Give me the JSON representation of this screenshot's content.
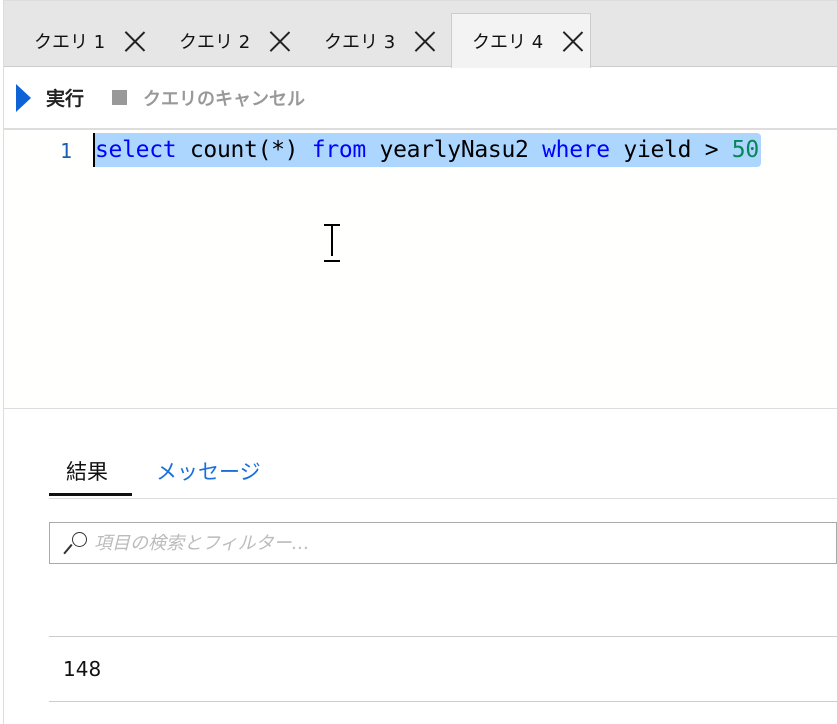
{
  "tabs": [
    {
      "label": "クエリ 1"
    },
    {
      "label": "クエリ 2"
    },
    {
      "label": "クエリ 3"
    },
    {
      "label": "クエリ 4",
      "active": true
    }
  ],
  "toolbar": {
    "run_label": "実行",
    "cancel_label": "クエリのキャンセル"
  },
  "editor": {
    "line_number": "1",
    "tokens": [
      "select",
      " count(*) ",
      "from",
      " yearlyNasu2 ",
      "where",
      " yield > ",
      "50"
    ]
  },
  "results": {
    "tabs": [
      "結果",
      "メッセージ"
    ],
    "search_placeholder": "項目の検索とフィルター…",
    "rows": [
      [
        "148"
      ]
    ]
  }
}
